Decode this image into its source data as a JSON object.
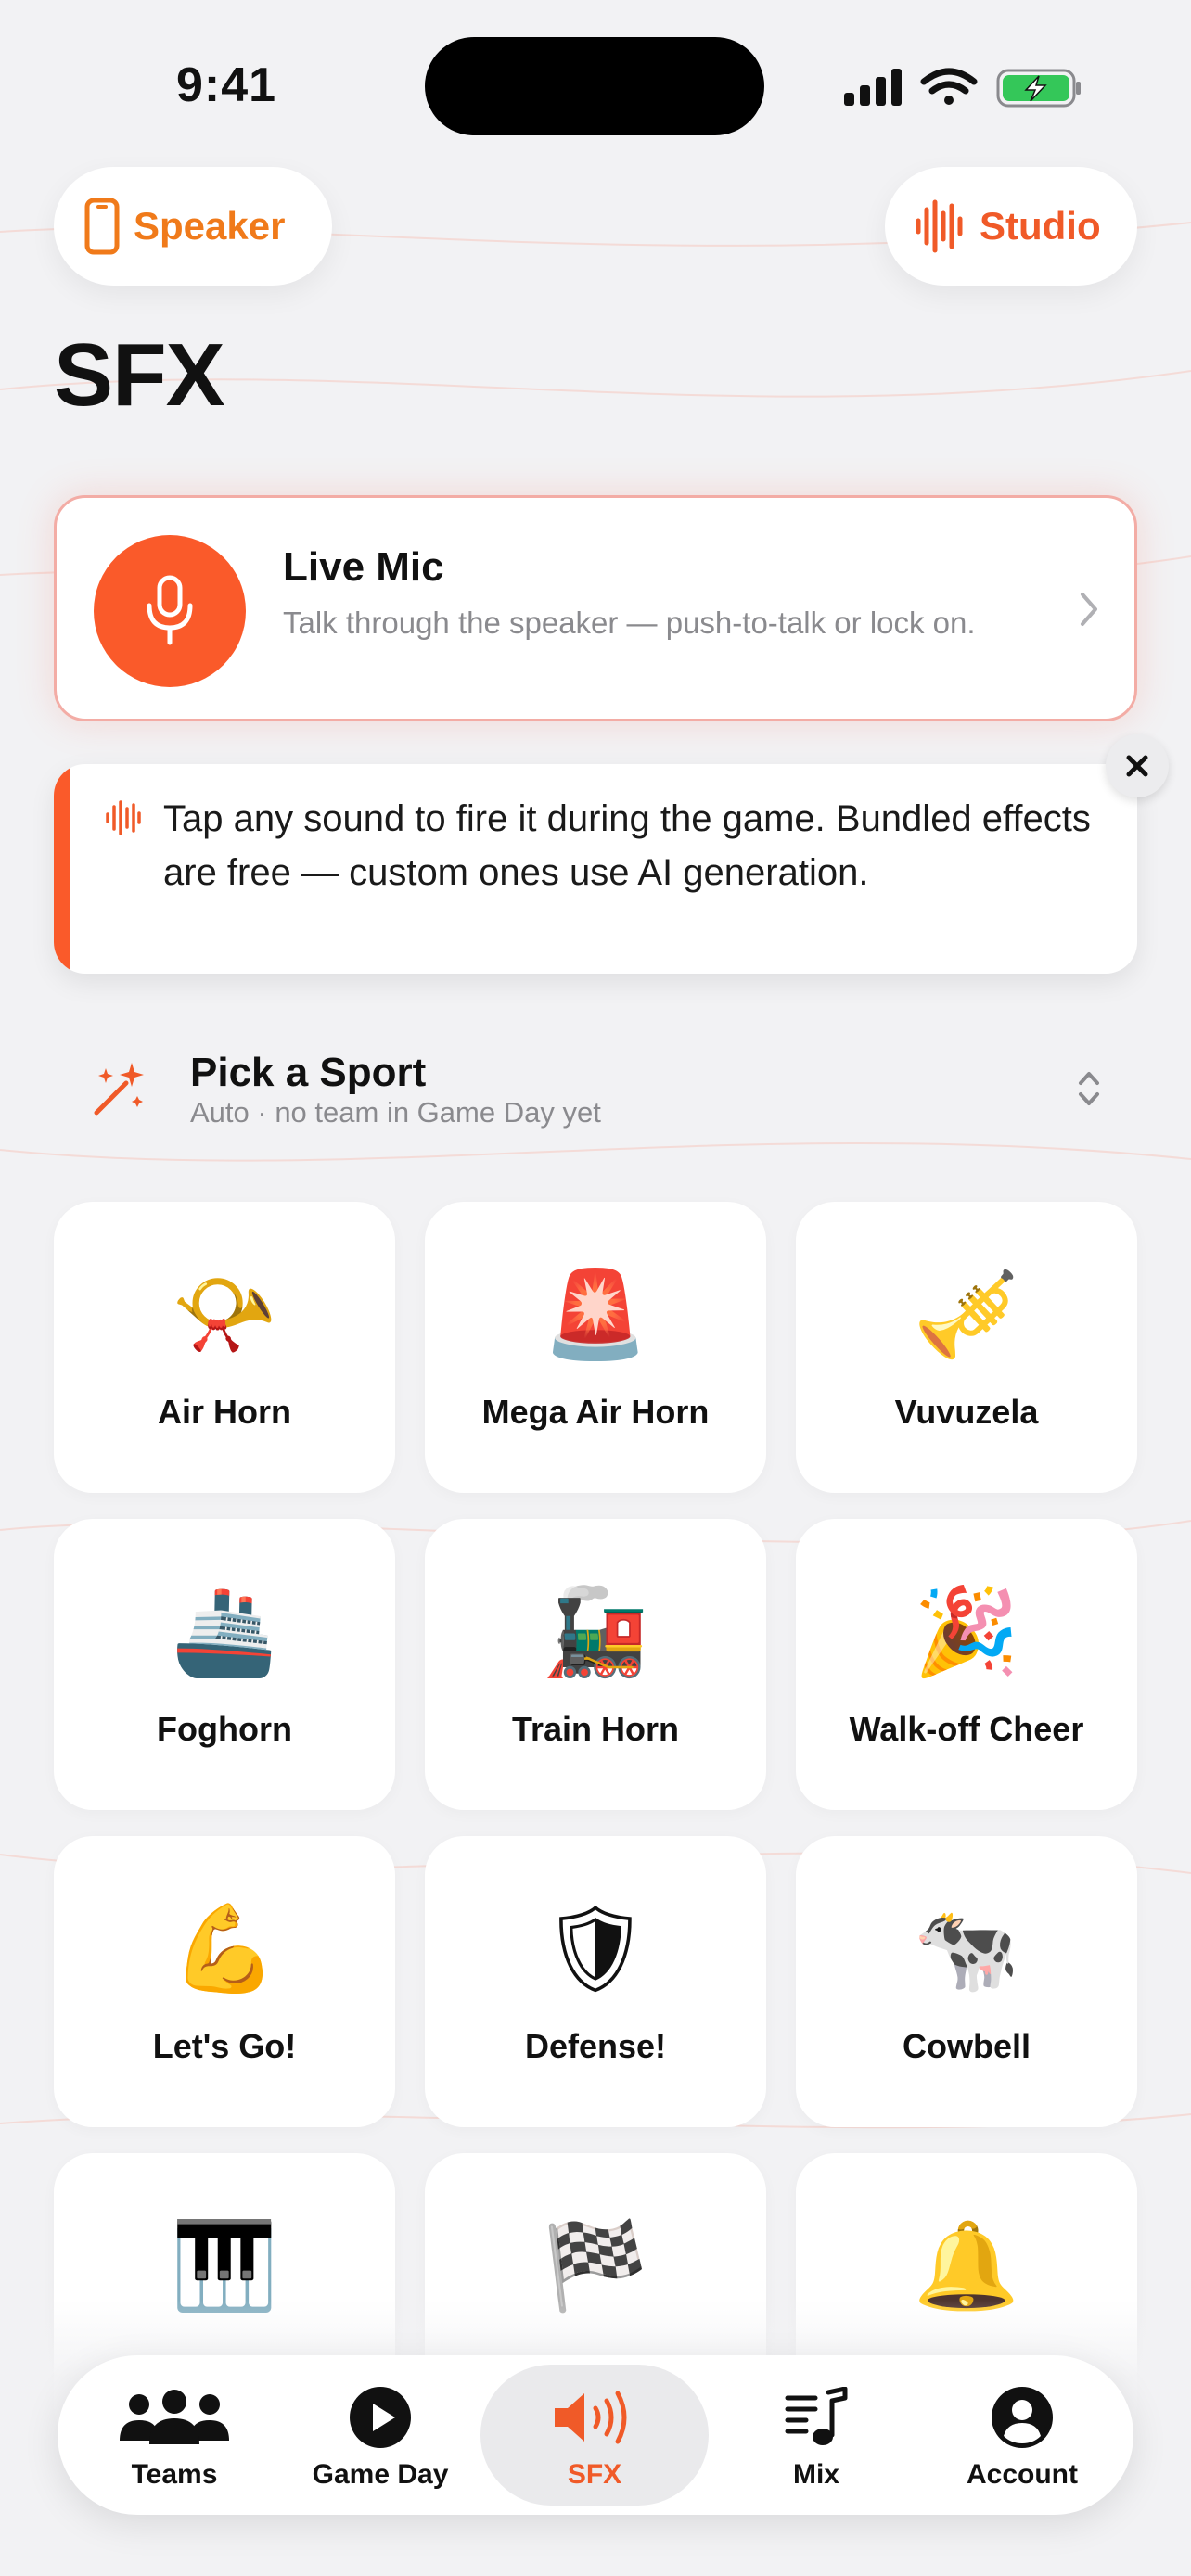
{
  "status_bar": {
    "time": "9:41"
  },
  "header": {
    "left_pill": {
      "label": "Speaker",
      "icon": "phone-icon"
    },
    "right_pill": {
      "label": "Studio",
      "icon": "waveform-icon"
    },
    "title": "SFX"
  },
  "live_mic": {
    "title": "Live Mic",
    "subtitle": "Talk through the speaker — push-to-talk or lock on.",
    "icon": "microphone-icon"
  },
  "tip": {
    "text": "Tap any sound to fire it during the game. Bundled effects are free — custom ones use AI generation.",
    "icon": "waveform-icon"
  },
  "sport_picker": {
    "title": "Pick a Sport",
    "subtitle": "Auto · no team in Game Day yet",
    "icon": "magic-wand-icon"
  },
  "sounds": [
    {
      "label": "Air Horn",
      "emoji": "📯"
    },
    {
      "label": "Mega Air Horn",
      "emoji": "🚨"
    },
    {
      "label": "Vuvuzela",
      "emoji": "🎺"
    },
    {
      "label": "Foghorn",
      "emoji": "🚢"
    },
    {
      "label": "Train Horn",
      "emoji": "🚂"
    },
    {
      "label": "Walk-off Cheer",
      "emoji": "🎉"
    },
    {
      "label": "Let's Go!",
      "emoji": "💪"
    },
    {
      "label": "Defense!",
      "emoji": "🛡"
    },
    {
      "label": "Cowbell",
      "emoji": "🐄"
    },
    {
      "label": "",
      "emoji": "🎹"
    },
    {
      "label": "",
      "emoji": "🏁"
    },
    {
      "label": "",
      "emoji": "🔔"
    }
  ],
  "tabs": [
    {
      "label": "Teams",
      "icon": "people-icon"
    },
    {
      "label": "Game Day",
      "icon": "play-circle-icon"
    },
    {
      "label": "SFX",
      "icon": "speaker-icon",
      "active": true
    },
    {
      "label": "Mix",
      "icon": "music-list-icon"
    },
    {
      "label": "Account",
      "icon": "person-circle-icon"
    }
  ],
  "colors": {
    "accent": "#f05a28",
    "orange": "#f07a1a",
    "background": "#f2f2f4"
  }
}
